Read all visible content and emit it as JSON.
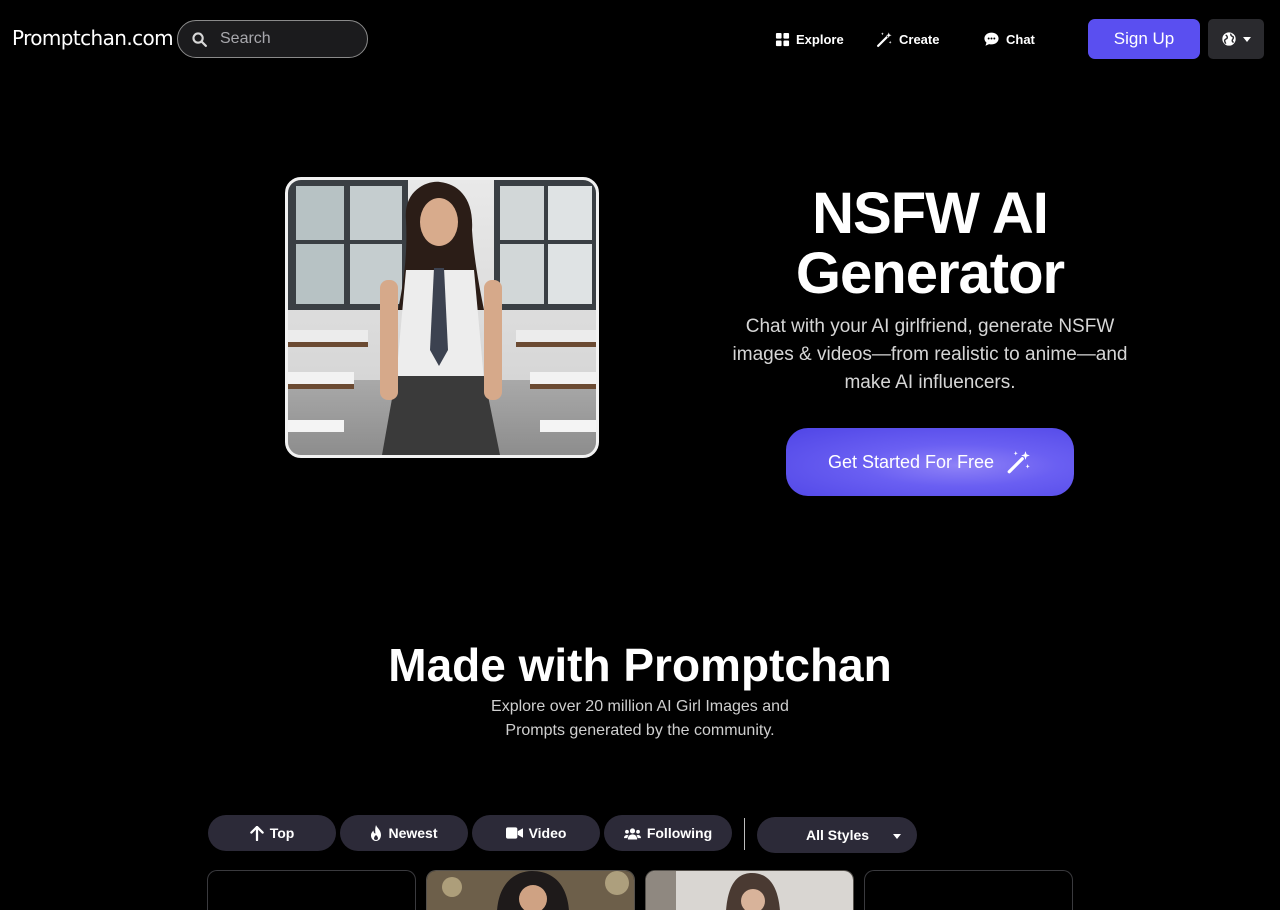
{
  "header": {
    "logo": "Promptchan.com",
    "search_placeholder": "Search",
    "nav": {
      "explore": "Explore",
      "create": "Create",
      "chat": "Chat"
    },
    "signup_label": "Sign Up"
  },
  "hero": {
    "title": "NSFW AI Generator",
    "subtitle": "Chat with your AI girlfriend, generate NSFW images & videos—from realistic to anime—and make AI influencers.",
    "cta_label": "Get Started For Free"
  },
  "gallery": {
    "title": "Made with Promptchan",
    "subtitle": "Explore over 20 million AI Girl Images and Prompts generated by the community.",
    "filters": {
      "top": "Top",
      "newest": "Newest",
      "video": "Video",
      "following": "Following"
    },
    "style_select": "All Styles"
  },
  "colors": {
    "accent": "#5a4ff0",
    "background": "#000000",
    "pill": "#2c2a38"
  }
}
